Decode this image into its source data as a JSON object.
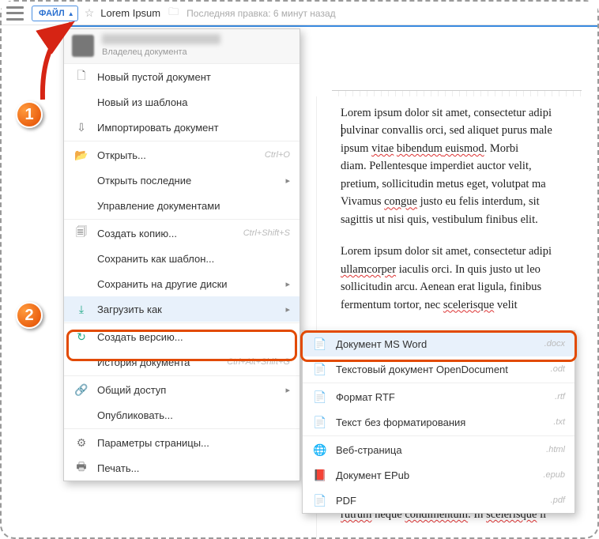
{
  "topbar": {
    "file_label": "ФАЙЛ",
    "doc_title": "Lorem Ipsum",
    "last_edit": "Последняя правка: 6 минут назад"
  },
  "badges": {
    "one": "1",
    "two": "2"
  },
  "owner": {
    "role": "Владелец документа"
  },
  "menu": {
    "new_blank": "Новый пустой документ",
    "new_template": "Новый из шаблона",
    "import_doc": "Импортировать документ",
    "open": "Открыть...",
    "open_sc": "Ctrl+O",
    "open_recent": "Открыть последние",
    "manage_docs": "Управление документами",
    "make_copy": "Создать копию...",
    "make_copy_sc": "Ctrl+Shift+S",
    "save_template": "Сохранить как шаблон...",
    "save_other_disks": "Сохранить на другие диски",
    "download_as": "Загрузить как",
    "create_version": "Создать версию...",
    "history": "История документа",
    "history_sc": "Ctrl+Alt+Shift+G",
    "share": "Общий доступ",
    "publish": "Опубликовать...",
    "page_setup": "Параметры страницы...",
    "print": "Печать..."
  },
  "submenu": {
    "msword": "Документ MS Word",
    "msword_ext": ".docx",
    "odt": "Текстовый документ OpenDocument",
    "odt_ext": ".odt",
    "rtf": "Формат RTF",
    "rtf_ext": ".rtf",
    "txt": "Текст без форматирования",
    "txt_ext": ".txt",
    "html": "Веб-страница",
    "html_ext": ".html",
    "epub": "Документ EPub",
    "epub_ext": ".epub",
    "pdf": "PDF",
    "pdf_ext": ".pdf"
  },
  "doc": {
    "p1a": "Lorem ipsum dolor sit amet, consectetur adipi",
    "p1b": "pulvinar convallis orci, sed aliquet purus male",
    "p1c": "ipsum ",
    "p1d": "vitae",
    "p1e": " ",
    "p1f": "bibendum",
    "p1g": " euismod",
    "p1h": ". Morbi ",
    "p1i": "diam. Pellentesque imperdiet auctor velit, ",
    "p1j": "pretium, sollicitudin metus eget, volutpat ma",
    "p1k": "Vivamus ",
    "p1l": "congue",
    "p1m": " justo eu felis interdum, sit ",
    "p1n": "sagittis ut nisi quis, vestibulum finibus elit.",
    "p2a": "Lorem ipsum dolor sit amet, consectetur adipi",
    "p2b": "ullamcorper",
    "p2c": " iaculis orci. In quis justo ut leo ",
    "p2d": "sollicitudin arcu. Aenean erat ligula, finibus ",
    "p2e": "fermentum tortor, nec ",
    "p2f": "scelerisque",
    "p2g": " velit ",
    "p3a": "rutrum",
    "p3b": " neque ",
    "p3c": "condimentum",
    "p3d": ". In ",
    "p3e": "scelerisque",
    "p3f": " li"
  }
}
